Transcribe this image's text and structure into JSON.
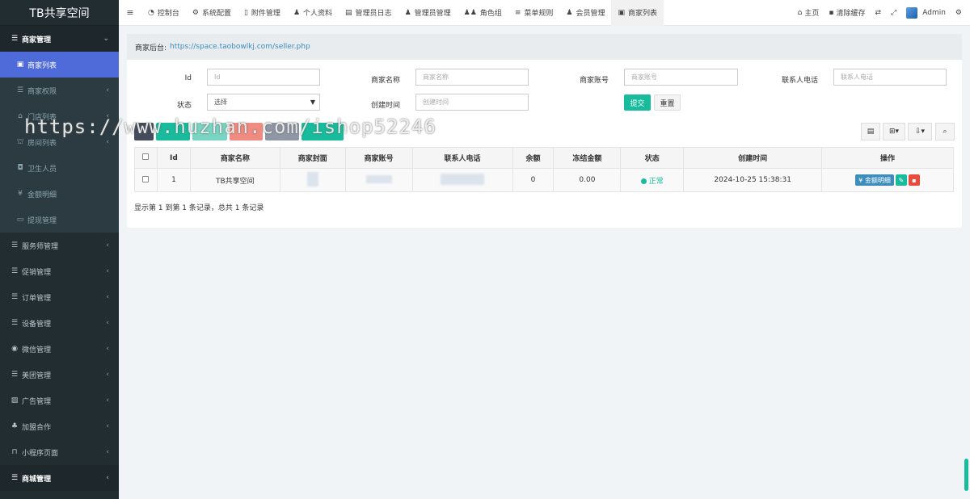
{
  "app": {
    "logo": "TB共享空间"
  },
  "sidebar": {
    "items": [
      {
        "label": "商家管理",
        "icon": "list-icon",
        "kind": "top"
      },
      {
        "label": "商家列表",
        "icon": "id-card-icon",
        "kind": "sub-active"
      },
      {
        "label": "商家权限",
        "icon": "list-icon",
        "kind": "sub"
      },
      {
        "label": "门店列表",
        "icon": "store-icon",
        "kind": "sub"
      },
      {
        "label": "房间列表",
        "icon": "bank-icon",
        "kind": "sub"
      },
      {
        "label": "卫生人员",
        "icon": "badge-icon",
        "kind": "sub"
      },
      {
        "label": "金额明细",
        "icon": "yen-icon",
        "kind": "sub"
      },
      {
        "label": "提现管理",
        "icon": "money-icon",
        "kind": "sub"
      },
      {
        "label": "服务师管理",
        "icon": "list-icon",
        "kind": "main"
      },
      {
        "label": "促销管理",
        "icon": "list-icon",
        "kind": "main"
      },
      {
        "label": "订单管理",
        "icon": "list-icon",
        "kind": "main"
      },
      {
        "label": "设备管理",
        "icon": "list-icon",
        "kind": "main"
      },
      {
        "label": "微信管理",
        "icon": "wechat-icon",
        "kind": "main"
      },
      {
        "label": "美团管理",
        "icon": "list-icon",
        "kind": "main"
      },
      {
        "label": "广告管理",
        "icon": "image-icon",
        "kind": "main"
      },
      {
        "label": "加盟合作",
        "icon": "user-plus-icon",
        "kind": "main"
      },
      {
        "label": "小程序页面",
        "icon": "bookmark-icon",
        "kind": "main"
      },
      {
        "label": "商城管理",
        "icon": "list-icon",
        "kind": "top2"
      }
    ]
  },
  "topbar": {
    "tabs": [
      "控制台",
      "系统配置",
      "附件管理",
      "个人资料",
      "管理员日志",
      "管理员管理",
      "角色组",
      "菜单规则",
      "会员管理",
      "商家列表"
    ],
    "home": "主页",
    "clear_cache": "清除缓存",
    "user": "Admin"
  },
  "page": {
    "url_label": "商家后台:",
    "url": "https://space.taobowlkj.com/seller.php"
  },
  "filters": {
    "id_label": "Id",
    "id_placeholder": "Id",
    "name_label": "商家名称",
    "name_placeholder": "商家名称",
    "account_label": "商家账号",
    "account_placeholder": "商家账号",
    "phone_label": "联系人电话",
    "phone_placeholder": "联系人电话",
    "status_label": "状态",
    "status_value": "选择",
    "created_label": "创建时间",
    "created_placeholder": "创建时间",
    "submit": "提交",
    "reset": "重置"
  },
  "table": {
    "headers": [
      "Id",
      "商家名称",
      "商家封面",
      "商家账号",
      "联系人电话",
      "余额",
      "冻结金额",
      "状态",
      "创建时间",
      "操作"
    ],
    "rows": [
      {
        "id": "1",
        "name": "TB共享空间",
        "balance": "0",
        "frozen": "0.00",
        "status": "正常",
        "created": "2024-10-25 15:38:31",
        "op_money": "¥ 金额明细"
      }
    ],
    "summary": "显示第 1 到第 1 条记录，总共 1 条记录"
  },
  "watermark": "https://www.huzhan.com/ishop52246",
  "colors": {
    "sidebar": "#222d32",
    "active": "#4f6bd9",
    "success": "#18bc9c",
    "danger": "#e74c3c",
    "primary": "#3c8dbc"
  }
}
